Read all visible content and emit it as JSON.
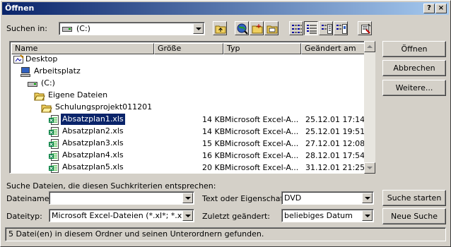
{
  "window": {
    "title": "Öffnen",
    "help_label": "?",
    "close_label": "×"
  },
  "toolbar": {
    "look_in_label": "Suchen in:",
    "look_in_value": "(C:)",
    "tools": [
      {
        "name": "up-folder",
        "icon": "folder-up-icon"
      },
      {
        "name": "search-web",
        "icon": "globe-search-icon"
      },
      {
        "name": "new-folder",
        "icon": "new-folder-icon"
      },
      {
        "name": "properties-folder",
        "icon": "folder-properties-icon"
      },
      {
        "name": "view-list",
        "icon": "list-view-icon"
      },
      {
        "name": "view-details",
        "icon": "details-view-icon"
      },
      {
        "name": "view-properties",
        "icon": "properties-view-icon"
      },
      {
        "name": "view-preview",
        "icon": "preview-view-icon"
      },
      {
        "name": "commands",
        "icon": "commands-icon"
      }
    ]
  },
  "columns": [
    "Name",
    "Größe",
    "Typ",
    "Geändert am"
  ],
  "tree": [
    {
      "label": "Desktop",
      "icon": "desktop-icon"
    },
    {
      "label": "Arbeitsplatz",
      "icon": "computer-icon"
    },
    {
      "label": "(C:)",
      "icon": "drive-icon"
    },
    {
      "label": "Eigene Dateien",
      "icon": "folder-open-icon"
    },
    {
      "label": "Schulungsprojekt011201",
      "icon": "folder-open-icon"
    }
  ],
  "files": [
    {
      "name": "Absatzplan1.xls",
      "size": "14 KB",
      "type": "Microsoft Excel-A...",
      "modified": "25.12.01 17:14",
      "selected": true
    },
    {
      "name": "Absatzplan2.xls",
      "size": "14 KB",
      "type": "Microsoft Excel-A...",
      "modified": "25.12.01 19:51",
      "selected": false
    },
    {
      "name": "Absatzplan3.xls",
      "size": "15 KB",
      "type": "Microsoft Excel-A...",
      "modified": "27.12.01 12:08",
      "selected": false
    },
    {
      "name": "Absatzplan4.xls",
      "size": "16 KB",
      "type": "Microsoft Excel-A...",
      "modified": "28.12.01 17:54",
      "selected": false
    },
    {
      "name": "Absatzplan5.xls",
      "size": "20 KB",
      "type": "Microsoft Excel-A...",
      "modified": "31.12.01 21:25",
      "selected": false
    }
  ],
  "buttons": {
    "open": "Öffnen",
    "cancel": "Abbrechen",
    "more": "Weitere...",
    "search_start": "Suche starten",
    "new_search": "Neue Suche"
  },
  "search": {
    "heading": "Suche Dateien, die diesen Suchkriterien entsprechen:",
    "filename_label": "Dateiname:",
    "filename_value": "",
    "filetype_label": "Dateityp:",
    "filetype_value": "Microsoft Excel-Dateien (*.xl*; *.xls; *",
    "text_label": "Text oder Eigenschaft:",
    "text_value": "DVD",
    "modified_label": "Zuletzt geändert:",
    "modified_value": "beliebiges Datum"
  },
  "status": "5 Datei(en) in diesem Ordner und seinen Unterordnern gefunden.",
  "colors": {
    "title_start": "#0a246a",
    "title_end": "#a6caf0",
    "selection": "#0a246a",
    "face": "#d4d0c8"
  }
}
